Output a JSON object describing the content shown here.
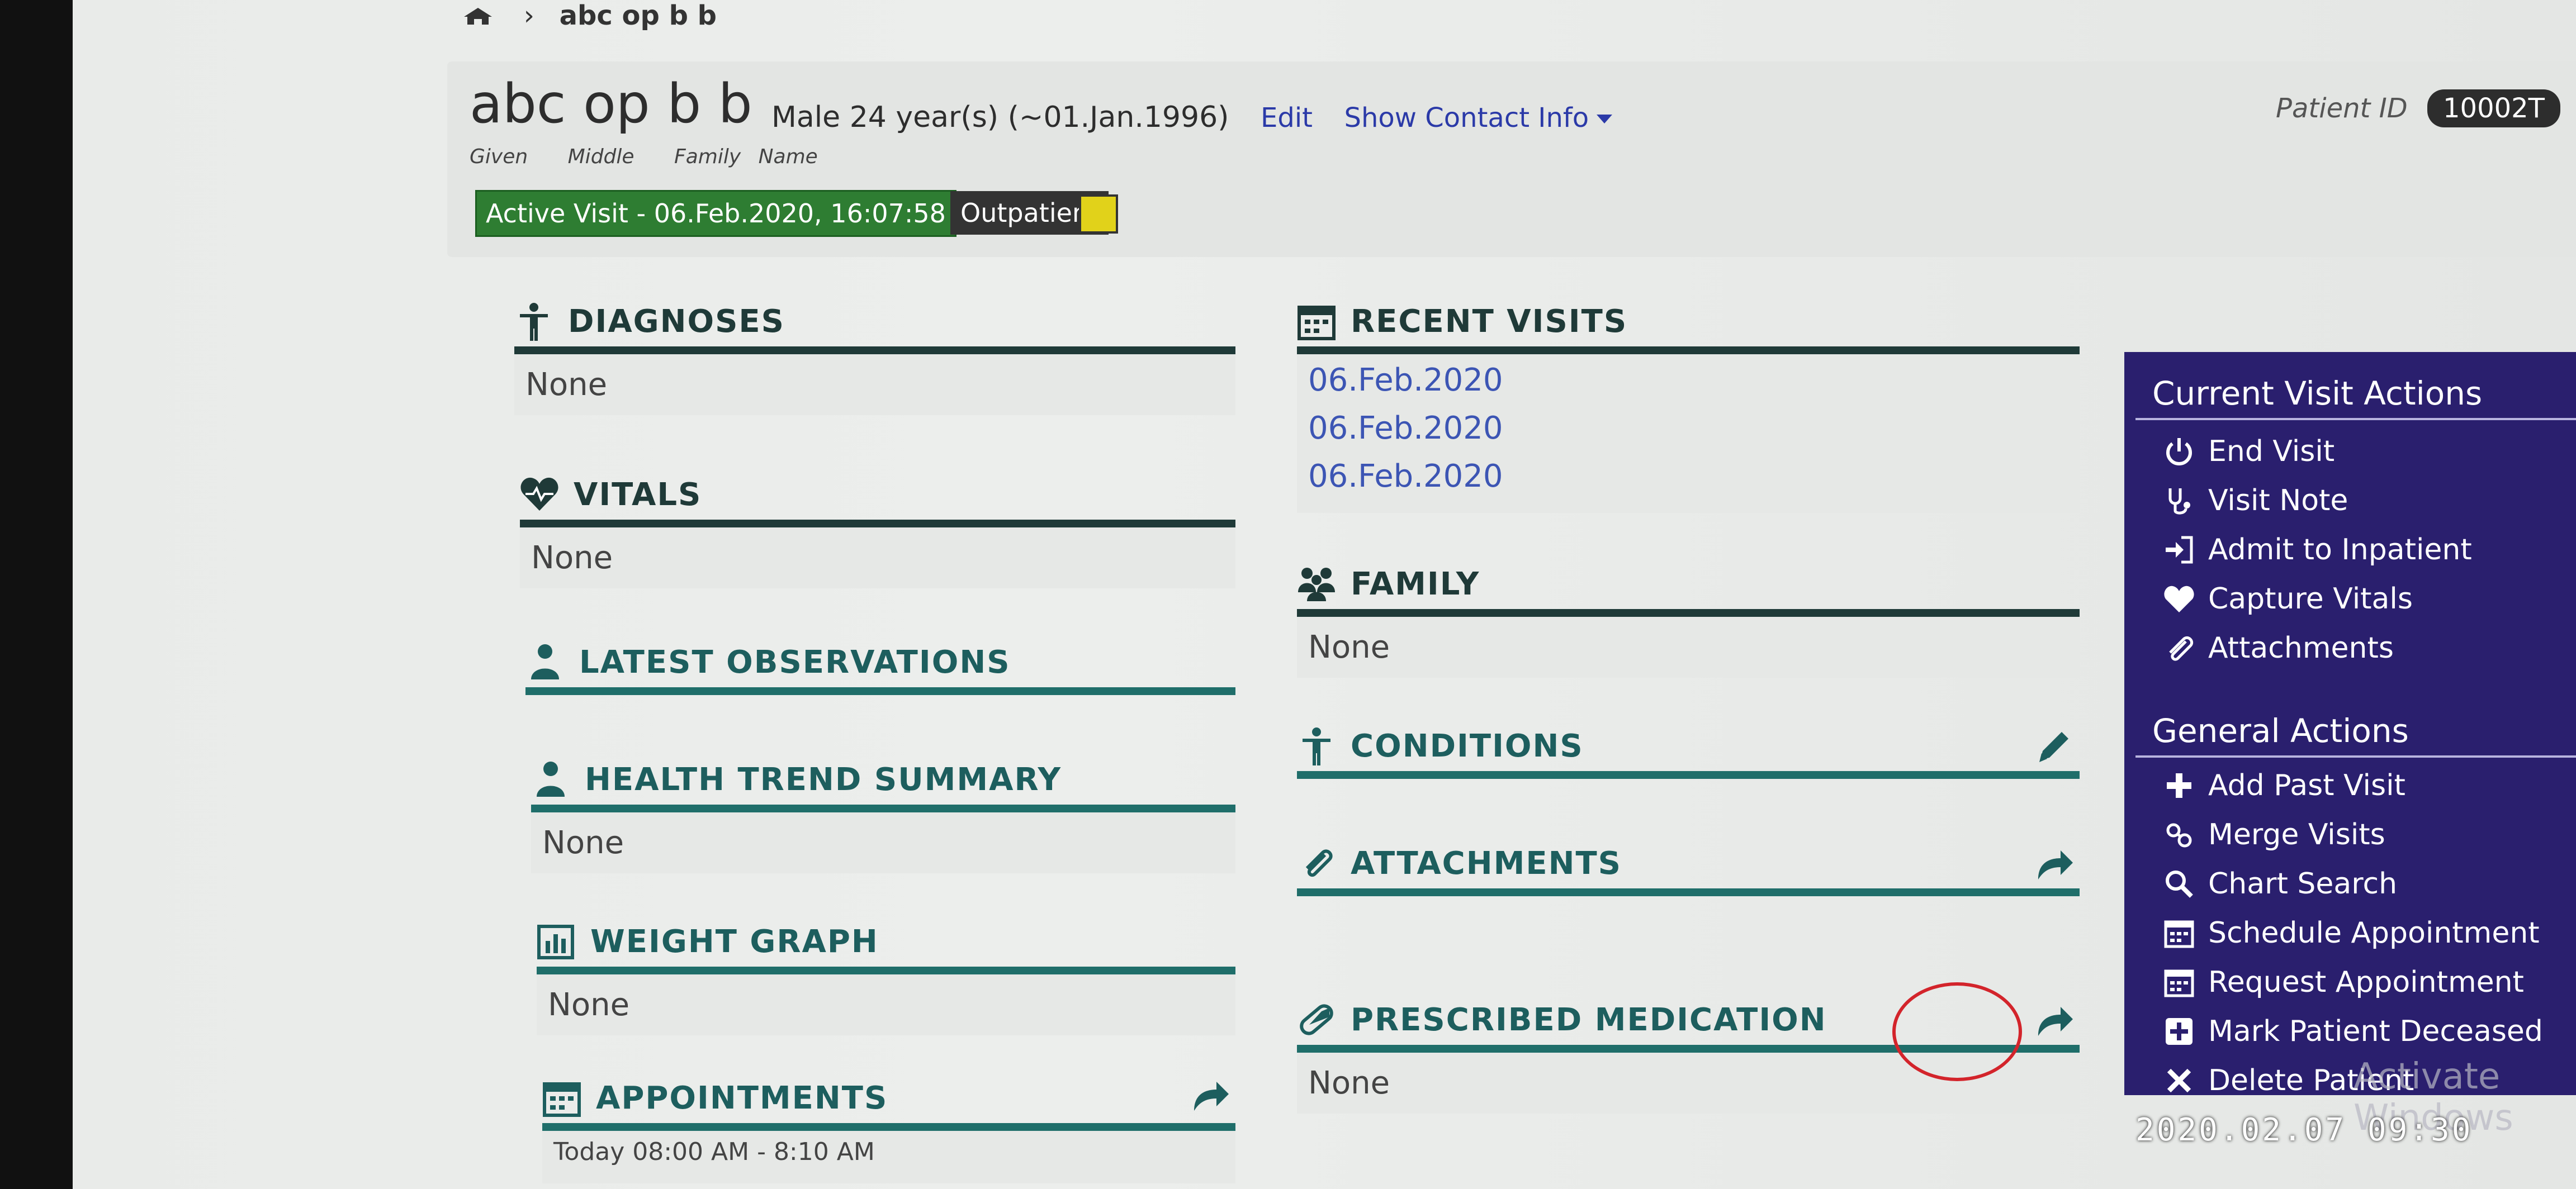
{
  "breadcrumb": {
    "current": "abc op b b"
  },
  "patient": {
    "name": "abc op b b",
    "labels": {
      "given": "Given",
      "middle": "Middle",
      "family": "Family Name"
    },
    "gender": "Male",
    "age": "24 year(s) (~01.Jan.1996)",
    "edit_label": "Edit",
    "contact_label": "Show Contact Info",
    "id_label": "Patient ID",
    "id_value": "10002T",
    "active_visit": "Active Visit - 06.Feb.2020, 16:07:58",
    "visit_type": "Outpatient"
  },
  "left_sections": {
    "diagnoses": {
      "title": "DIAGNOSES",
      "body": "None"
    },
    "vitals": {
      "title": "VITALS",
      "body": "None"
    },
    "observations": {
      "title": "LATEST OBSERVATIONS"
    },
    "health_trend": {
      "title": "HEALTH TREND SUMMARY",
      "body": "None"
    },
    "weight": {
      "title": "WEIGHT GRAPH",
      "body": "None"
    },
    "appointments": {
      "title": "APPOINTMENTS",
      "body": "Today 08:00 AM - 8:10 AM"
    }
  },
  "mid_sections": {
    "recent_visits": {
      "title": "RECENT VISITS",
      "items": [
        "06.Feb.2020",
        "06.Feb.2020",
        "06.Feb.2020"
      ]
    },
    "family": {
      "title": "FAMILY",
      "body": "None"
    },
    "conditions": {
      "title": "CONDITIONS"
    },
    "attachments": {
      "title": "ATTACHMENTS"
    },
    "medication": {
      "title": "PRESCRIBED MEDICATION",
      "body": "None"
    }
  },
  "actions": {
    "current_title": "Current Visit Actions",
    "current": [
      "End Visit",
      "Visit Note",
      "Admit to Inpatient",
      "Capture Vitals",
      "Attachments"
    ],
    "general_title": "General Actions",
    "general": [
      "Add Past Visit",
      "Merge Visits",
      "Chart Search",
      "Schedule Appointment",
      "Request Appointment",
      "Mark Patient Deceased",
      "Delete Patient"
    ]
  },
  "watermark": "Activate Windows",
  "timestamp": "2020.02.07 09:30",
  "colors": {
    "accent": "#1f6e6a",
    "panel": "#2a1f6e",
    "visit": "#2e7d32",
    "link": "#3c55b4"
  }
}
